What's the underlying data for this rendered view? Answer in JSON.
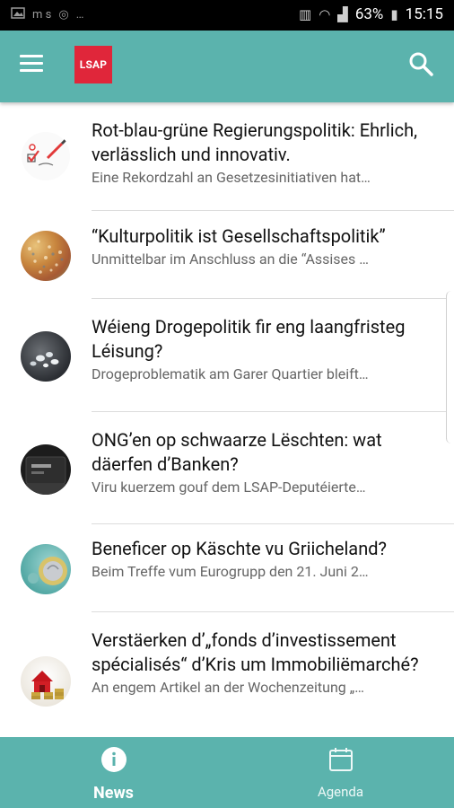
{
  "status_bar": {
    "left_text": "m s",
    "battery": "63%",
    "time": "15:15"
  },
  "app_bar": {
    "logo_text": "LSAP",
    "brand_color": "#e0263a",
    "accent_color": "#5bb3ad",
    "icons": [
      "menu-icon",
      "search-icon"
    ]
  },
  "articles": [
    {
      "title": "Rot-blau-grüne Regierungspolitik: Ehrlich, verlässlich und innovativ.",
      "excerpt": "Eine Rekordzahl an Gesetzesinitiativen hat…"
    },
    {
      "title": "“Kulturpolitik ist Gesellschaftspolitik”",
      "excerpt": "Unmittelbar im Anschluss an die “Assises …"
    },
    {
      "title": "Wéieng Drogepolitik fir eng laangfristeg Léisung?",
      "excerpt": "Drogeproblematik am Garer Quartier bleift…"
    },
    {
      "title": "ONG’en op schwaarze Lëschten: wat däerfen d’Banken?",
      "excerpt": "Viru kuerzem gouf dem LSAP-Deputéierte…"
    },
    {
      "title": "Beneficer op Käschte vu Griicheland?",
      "excerpt": "Beim Treffe vum Eurogrupp den 21. Juni 2…"
    },
    {
      "title": "Verstäerken d’„fonds d’investissement spécialisés“ d’Kris um Immobiliëmarché?",
      "excerpt": "An engem Artikel an der Wochenzeitung „…"
    }
  ],
  "bottom_nav": {
    "news_label": "News",
    "agenda_label": "Agenda",
    "active": "news"
  }
}
